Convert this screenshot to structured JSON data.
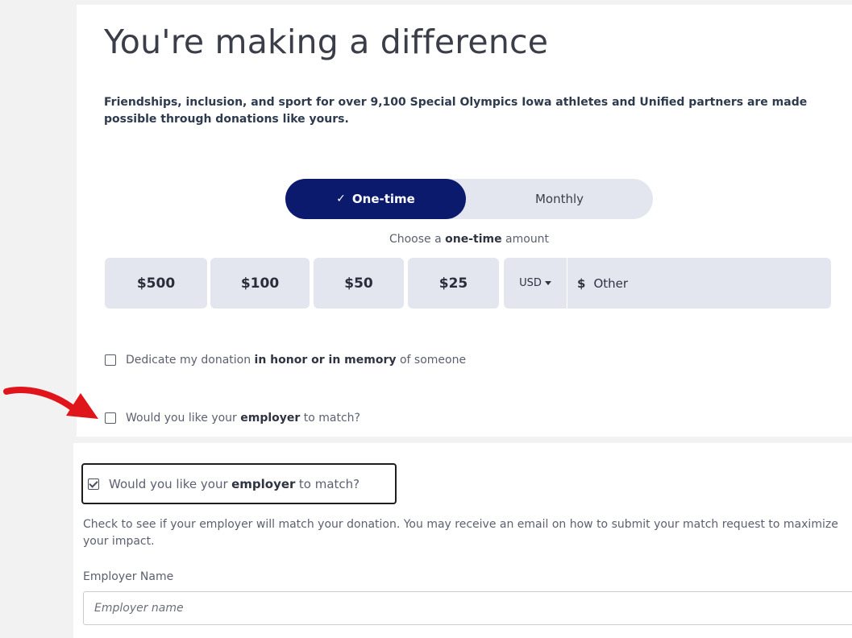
{
  "heading": "You're making a difference",
  "intro": "Friendships, inclusion, and sport for over 9,100 Special Olympics Iowa athletes and Unified partners are made possible through donations like yours.",
  "frequency": {
    "one_time": "One-time",
    "monthly": "Monthly",
    "check_glyph": "✓"
  },
  "choose": {
    "prefix": "Choose a",
    "emphasis": "one-time",
    "suffix": "amount"
  },
  "amounts": [
    "$500",
    "$100",
    "$50",
    "$25"
  ],
  "currency": "USD",
  "other": {
    "symbol": "$",
    "label": "Other"
  },
  "dedicate": {
    "prefix": "Dedicate my donation",
    "emphasis": "in honor or in memory",
    "suffix": "of someone"
  },
  "employer_match": {
    "prefix": "Would you like your",
    "emphasis": "employer",
    "suffix": "to match?"
  },
  "match_description": "Check to see if your employer will match your donation. You may receive an email on how to submit your match request to maximize your impact.",
  "employer_field": {
    "label": "Employer Name",
    "placeholder": "Employer name"
  },
  "colors": {
    "accent_navy": "#0b1a6d",
    "tile_bg": "#e3e5ef",
    "arrow_red": "#e0141b"
  }
}
